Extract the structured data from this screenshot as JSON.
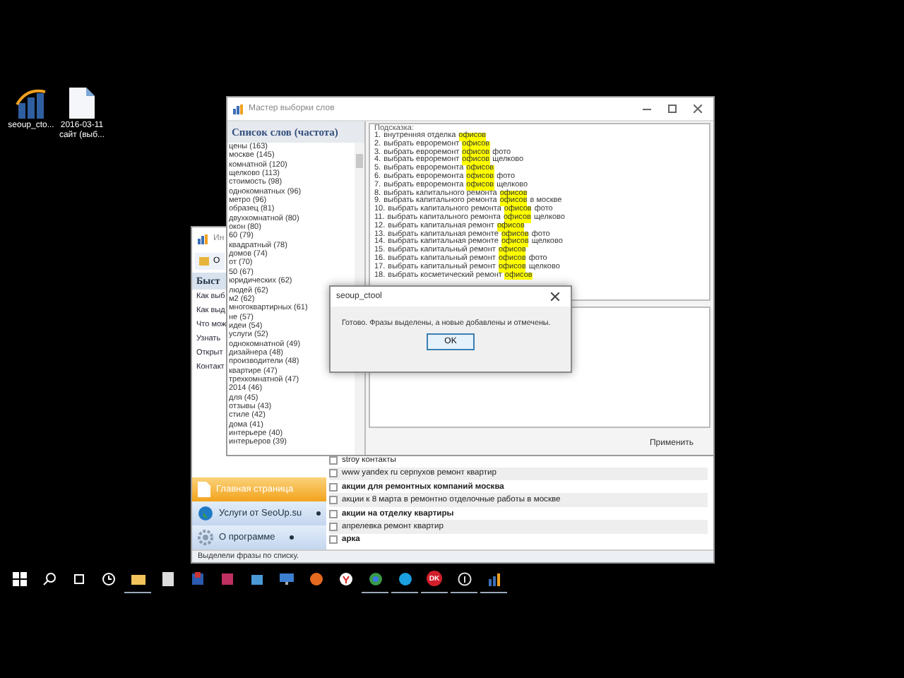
{
  "desktop_icons": [
    {
      "kind": "app",
      "label": "seoup_cto..."
    },
    {
      "kind": "file",
      "label": "2016-03-11 сайт (выб..."
    }
  ],
  "main_window": {
    "title": "Ин",
    "toolbar_button": "О",
    "quick_header": "Быст",
    "quick_links": [
      "Как выб",
      "Как выд",
      "Что мож",
      "Узнать",
      "Открыт",
      "Контакт"
    ],
    "nav": [
      {
        "kind": "page",
        "label": "Главная страница",
        "selected": true,
        "submenu": false
      },
      {
        "kind": "globe",
        "label": "Услуги от SeoUp.su",
        "selected": false,
        "submenu": true
      },
      {
        "kind": "gear",
        "label": "О программе",
        "selected": false,
        "submenu": true
      }
    ],
    "phrases": [
      {
        "text": "stroy контакты",
        "checked": false,
        "bold": false
      },
      {
        "text": "www yandex ru серпухов ремонт квартир",
        "checked": false,
        "bold": false
      },
      {
        "text": "акции для ремонтных компаний москва",
        "checked": false,
        "bold": true
      },
      {
        "text": "акции к 8 марта в ремонтно отделочные работы в москве",
        "checked": false,
        "bold": false
      },
      {
        "text": "акции на отделку квартиры",
        "checked": false,
        "bold": true
      },
      {
        "text": "апрелевка ремонт квартир",
        "checked": false,
        "bold": false
      },
      {
        "text": "арка",
        "checked": false,
        "bold": true
      }
    ],
    "status_bar": "Выделели фразы по списку."
  },
  "wizard": {
    "title": "Мастер выборки слов",
    "words_header": "Список слов (частота)",
    "words": [
      "цены (163)",
      "москве (145)",
      "комнатной (120)",
      "щелково (113)",
      "стоимость (98)",
      "однокомнатных (96)",
      "метро (96)",
      "образец (81)",
      "двухкомнатной (80)",
      "окон (80)",
      "60 (79)",
      "квадратный (78)",
      "домов (74)",
      "от (70)",
      "50 (67)",
      "юридических (62)",
      "людей (62)",
      "м2 (62)",
      "многоквартирных (61)",
      "не (57)",
      "идеи (54)",
      "услуги (52)",
      "однокомнатной (49)",
      "дизайнера (48)",
      "производители (48)",
      "квартире (47)",
      "трехкомнатной (47)",
      "2014 (46)",
      "для (45)",
      "отзывы (43)",
      "стиле (42)",
      "дома (41)",
      "интерьере (40)",
      "интерьеров (39)"
    ],
    "hints_label": "Подсказка:",
    "hints": [
      {
        "num": "1.",
        "before": "внутренняя отделка",
        "keyword": "офисов"
      },
      {
        "num": "2.",
        "before": "выбрать евроремонт",
        "keyword": "офисов"
      },
      {
        "num": "3.",
        "before": "выбрать евроремонт",
        "keyword": "офисов",
        "after": "фото"
      },
      {
        "num": "4.",
        "before": "выбрать евроремонт",
        "keyword": "офисов",
        "after": "щелково"
      },
      {
        "num": "5.",
        "before": "выбрать евроремонта",
        "keyword": "офисов"
      },
      {
        "num": "6.",
        "before": "выбрать евроремонта",
        "keyword": "офисов",
        "after": "фото"
      },
      {
        "num": "7.",
        "before": "выбрать евроремонта",
        "keyword": "офисов",
        "after": "щелково"
      },
      {
        "num": "8.",
        "before": "выбрать капитального ремонта",
        "keyword": "офисов"
      },
      {
        "num": "9.",
        "before": "выбрать капитального ремонта",
        "keyword": "офисов",
        "after": "в москве"
      },
      {
        "num": "10.",
        "before": "выбрать капитального ремонта",
        "keyword": "офисов",
        "after": "фото"
      },
      {
        "num": "11.",
        "before": "выбрать капитального ремонта",
        "keyword": "офисов",
        "after": "щелково"
      },
      {
        "num": "12.",
        "before": "выбрать капитальная ремонт",
        "keyword": "офисов"
      },
      {
        "num": "13.",
        "before": "выбрать капитальная ремонте",
        "keyword": "офисов",
        "after": "фото"
      },
      {
        "num": "14.",
        "before": "выбрать капитальная ремонте",
        "keyword": "офисов",
        "after": "щелково"
      },
      {
        "num": "15.",
        "before": "выбрать капитальный ремонт",
        "keyword": "офисов"
      },
      {
        "num": "16.",
        "before": "выбрать капитальный ремонт",
        "keyword": "офисов",
        "after": "фото"
      },
      {
        "num": "17.",
        "before": "выбрать капитальный ремонт",
        "keyword": "офисов",
        "after": "щелково"
      },
      {
        "num": "18.",
        "before": "выбрать косметический ремонт",
        "keyword": "офисов"
      }
    ],
    "apply_button": "Применить"
  },
  "dialog": {
    "title": "seoup_ctool",
    "message": "Готово. Фразы выделены, а новые добавлены и отмечены.",
    "ok_button": "OK"
  },
  "taskbar": [
    {
      "kind": "start",
      "running": false
    },
    {
      "kind": "search",
      "running": false
    },
    {
      "kind": "taskview",
      "running": false
    },
    {
      "kind": "clock",
      "running": false
    },
    {
      "kind": "folder",
      "running": true
    },
    {
      "kind": "calculator",
      "running": false
    },
    {
      "kind": "red-app",
      "running": false
    },
    {
      "kind": "pink-app",
      "running": false
    },
    {
      "kind": "store",
      "running": false
    },
    {
      "kind": "monitor",
      "running": false
    },
    {
      "kind": "firefox",
      "running": false
    },
    {
      "kind": "yandex",
      "running": false
    },
    {
      "kind": "chrome",
      "running": true
    },
    {
      "kind": "skype",
      "running": true
    },
    {
      "kind": "dk",
      "running": true,
      "label": "DK"
    },
    {
      "kind": "info",
      "running": true
    },
    {
      "kind": "seoup",
      "running": true
    }
  ]
}
